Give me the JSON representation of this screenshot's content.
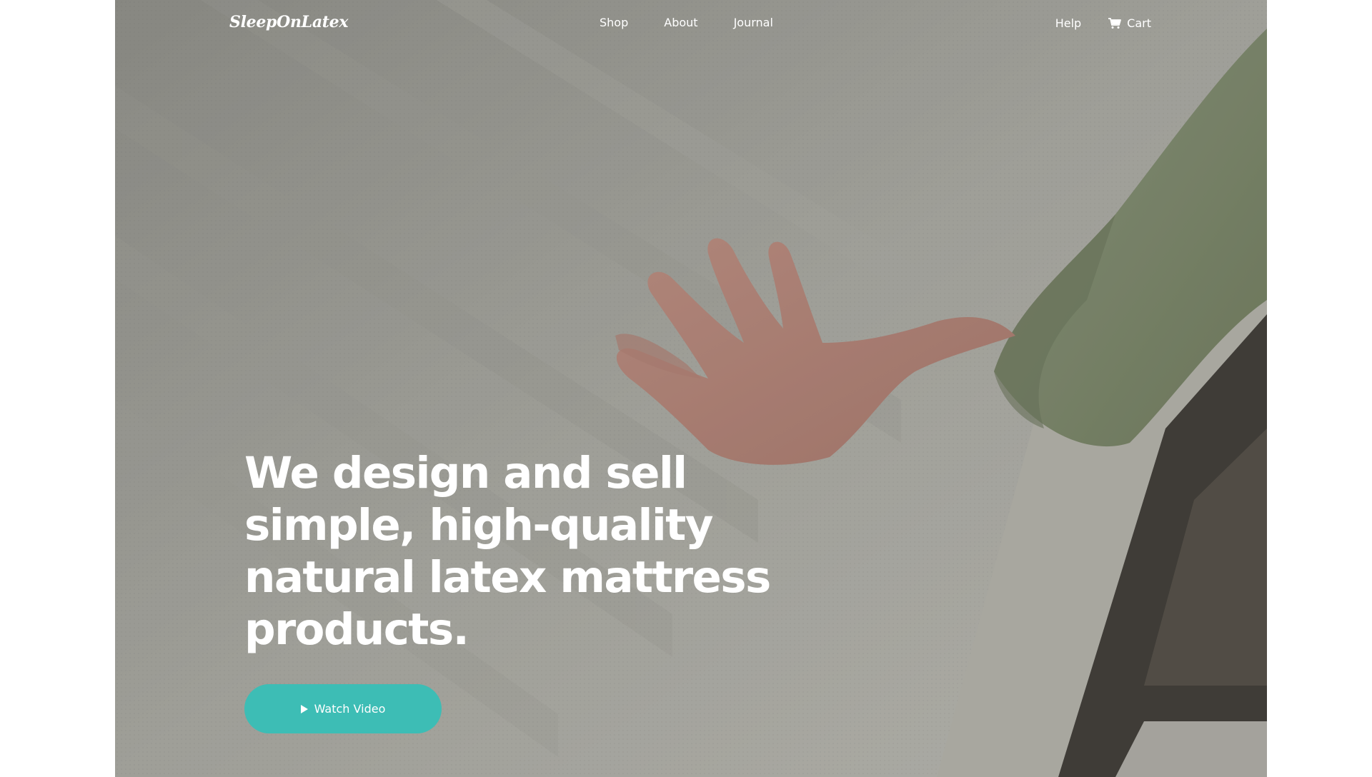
{
  "header": {
    "logo": "SleepOnLatex",
    "nav": [
      {
        "label": "Shop"
      },
      {
        "label": "About"
      },
      {
        "label": "Journal"
      }
    ],
    "help_label": "Help",
    "cart_label": "Cart",
    "cart_icon": "cart-icon"
  },
  "hero": {
    "headline": "We design and sell simple, high-quality natural latex mattress products.",
    "button_label": "Watch Video",
    "button_icon": "play-icon",
    "image_subject": "hand pressing on a white knit-covered latex mattress, green sleeve"
  },
  "colors": {
    "accent": "#3dbdb5",
    "text": "#ffffff",
    "page_background": "#ffffff"
  }
}
